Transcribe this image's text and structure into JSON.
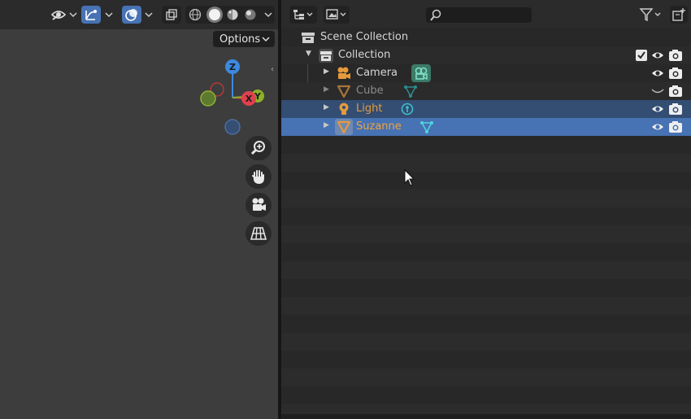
{
  "viewport": {
    "options_label": "Options",
    "gizmo": {
      "z_label": "Z",
      "y_label": "Y",
      "x_label": "X"
    },
    "icons": [
      "visibility-selector-icon",
      "gizmo-toggle-icon",
      "overlay-toggle-icon",
      "xray-icon",
      "wireframe-shading-icon",
      "solid-shading-icon",
      "material-shading-icon",
      "rendered-shading-icon"
    ],
    "nav_icons": [
      "zoom-icon",
      "pan-hand-icon",
      "camera-view-icon",
      "perspective-grid-icon"
    ]
  },
  "outliner": {
    "search_placeholder": "",
    "colors": {
      "selected_active": "#4772b3",
      "selected": "#334d73",
      "object_orange": "#e59a3c",
      "mesh_data_cyan": "#3fc1c9"
    },
    "rows": {
      "scene_collection": {
        "label": "Scene Collection"
      },
      "collection": {
        "label": "Collection",
        "checked": true
      },
      "camera": {
        "label": "Camera"
      },
      "cube": {
        "label": "Cube",
        "hidden": true
      },
      "light": {
        "label": "Light",
        "selected": true
      },
      "suzanne": {
        "label": "Suzanne",
        "active": true
      }
    }
  }
}
